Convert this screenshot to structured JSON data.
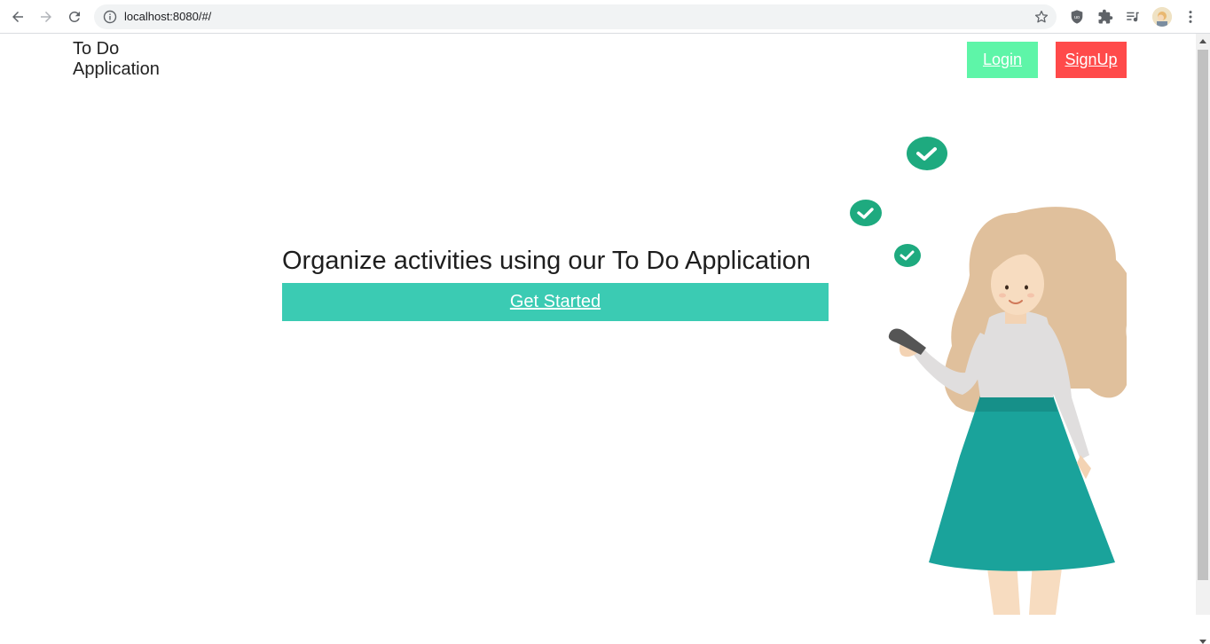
{
  "browser": {
    "url": "localhost:8080/#/",
    "icons": {
      "back": "back-arrow-icon",
      "forward": "forward-arrow-icon",
      "reload": "reload-icon",
      "info": "info-icon",
      "bookmark": "star-icon",
      "extensions": [
        "ublock-shield-icon",
        "puzzle-piece-icon",
        "media-queue-icon"
      ],
      "menu": "kebab-menu-icon"
    }
  },
  "header": {
    "brand": "To Do Application",
    "login_label": "Login",
    "signup_label": "SignUp"
  },
  "hero": {
    "headline": "Organize activities using our To Do Application",
    "cta_label": "Get Started"
  },
  "colors": {
    "login": "#5ef5a8",
    "signup": "#ff4a4a",
    "cta": "#3bcbb3",
    "check": "#1eaa7f",
    "skirt": "#1aa39b"
  }
}
